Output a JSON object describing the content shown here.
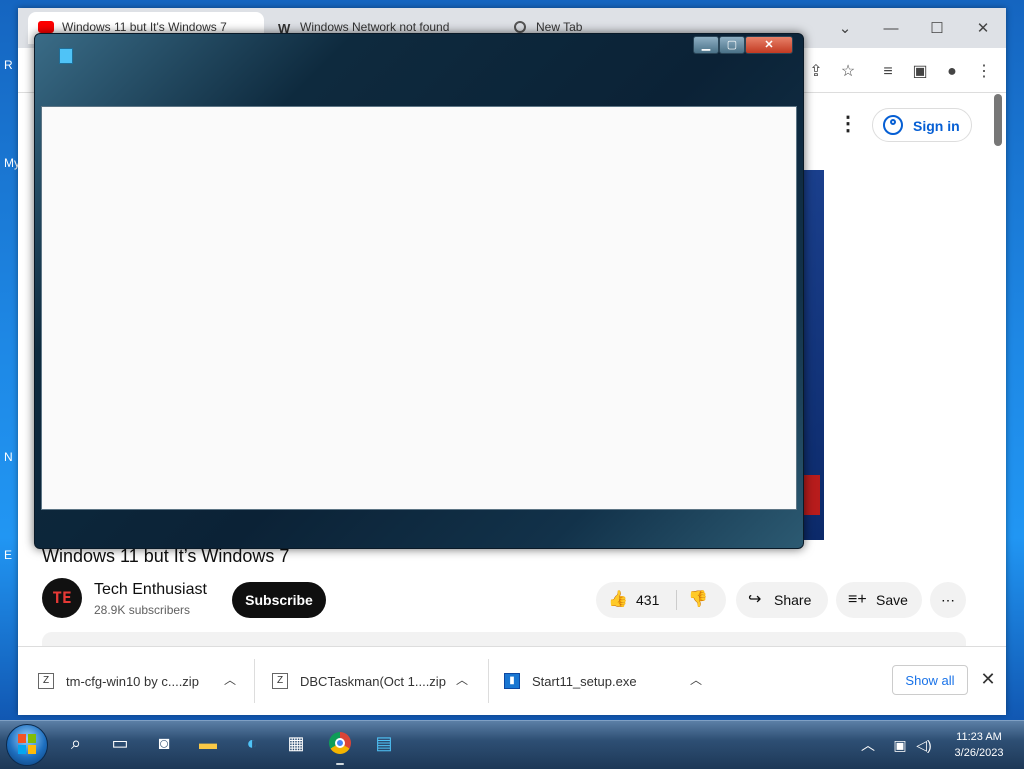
{
  "desktop": {
    "fragments": [
      "R",
      "My",
      "N",
      "E"
    ]
  },
  "browser": {
    "tabs": [
      "Windows 11 but It's Windows 7",
      "Windows Network not found",
      "New Tab"
    ],
    "youtube": {
      "sign_in": "Sign in",
      "video_title": "Windows 11 but It’s Windows 7",
      "channel": {
        "avatar_text": "TE",
        "name": "Tech Enthusiast",
        "subscribers": "28.9K subscribers"
      },
      "subscribe": "Subscribe",
      "likes": "431",
      "share": "Share",
      "save": "Save"
    },
    "downloads": {
      "items": [
        {
          "name": "tm-cfg-win10 by c....zip"
        },
        {
          "name": "DBCTaskman(Oct 1....zip"
        },
        {
          "name": "Start11_setup.exe"
        }
      ],
      "show_all": "Show all"
    }
  },
  "taskbar": {
    "clock_time": "11:23 AM",
    "clock_date": "3/26/2023"
  },
  "colors": {
    "accent": "#065fd4",
    "subscribe_bg": "#0f0f0f",
    "aero_close": "#c23a22"
  }
}
